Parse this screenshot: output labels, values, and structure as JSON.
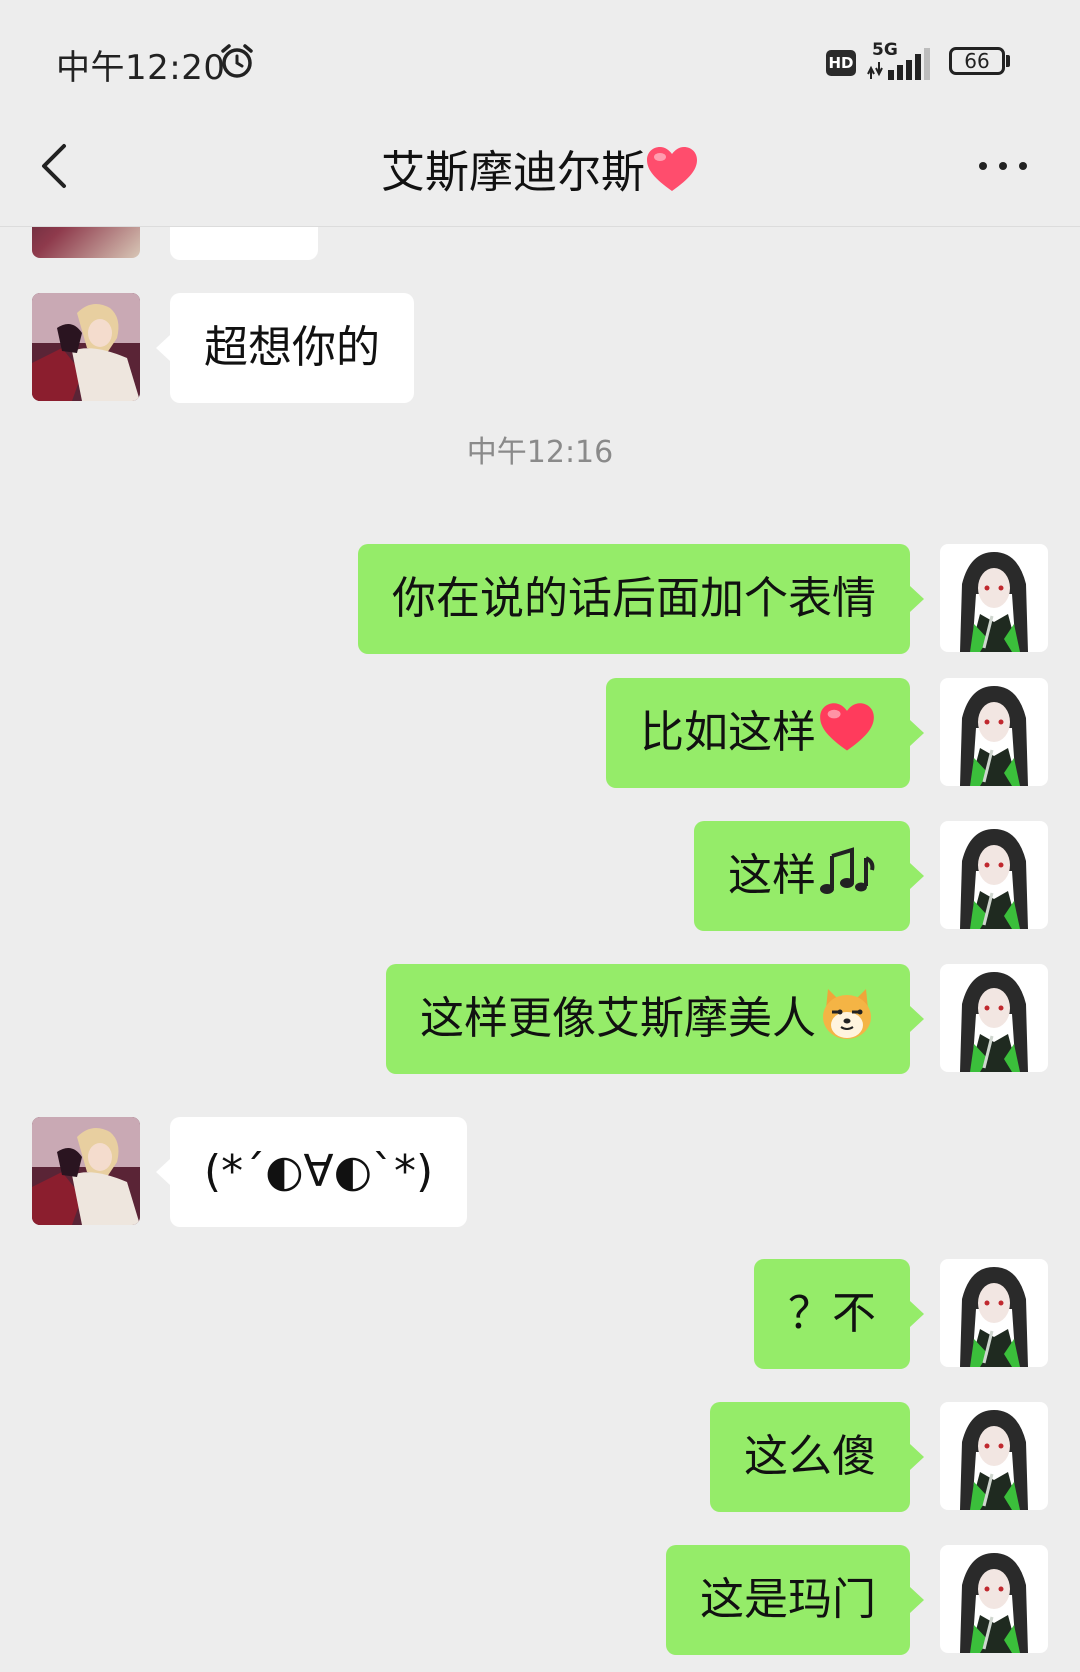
{
  "status_bar": {
    "time": "中午12:20",
    "hd": "HD",
    "network": "5G",
    "battery": "66",
    "battery_level": 0.66
  },
  "header": {
    "title": "艾斯摩迪尔斯",
    "title_emoji": "heart-icon",
    "back": "back-icon",
    "more": "more-icon"
  },
  "messages": [
    {
      "side": "in",
      "text": "超想你的"
    },
    {
      "timestamp": "中午12:16"
    },
    {
      "side": "out",
      "text": "你在说的话后面加个表情"
    },
    {
      "side": "out",
      "text": "比如这样",
      "emoji": "heart-icon"
    },
    {
      "side": "out",
      "text": "这样",
      "emoji": "music-notes-icon"
    },
    {
      "side": "out",
      "text": "这样更像艾斯摩美人",
      "emoji": "doge-icon"
    },
    {
      "side": "in",
      "text": "(*´◐∀◐`*)"
    },
    {
      "side": "out",
      "text": "？不"
    },
    {
      "side": "out",
      "text": "这么傻"
    },
    {
      "side": "out",
      "text": "这是玛门"
    }
  ],
  "colors": {
    "background": "#ededed",
    "outgoing_bubble": "#95ec69",
    "incoming_bubble": "#ffffff",
    "timestamp": "#8a8a8a"
  }
}
